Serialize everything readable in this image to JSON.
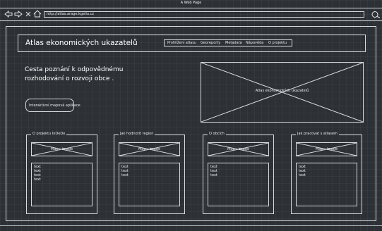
{
  "window": {
    "title": "A Web Page"
  },
  "browser": {
    "url": "http://atlas.arage.kgeliu.cz"
  },
  "header": {
    "site_title": "Atlas ekonomických ukazatelů",
    "nav": [
      "Prohlížení atlasu",
      "Georeporty",
      "Metadata",
      "Nápověda",
      "O projektu"
    ]
  },
  "hero": {
    "tagline_line1": "Cesta poznání k odpovědnému",
    "tagline_line2": "rozhodování o rozvoji obce .",
    "button_label": "Interaktivní mapová aplikace",
    "image_label": "Atlas ekonomických ukazatelů"
  },
  "cards": [
    {
      "title": "O projektu InDeDe",
      "image_label": "Map - image",
      "lines": [
        "text",
        "text",
        "text",
        "text"
      ]
    },
    {
      "title": "Jak hodnotit region",
      "image_label": "Map - image",
      "lines": [
        "text",
        "text",
        "text"
      ]
    },
    {
      "title": "O obcích",
      "image_label": "Map - image",
      "lines": [
        "text",
        "text",
        "text"
      ]
    },
    {
      "title": "Jak pracovat s atlasem",
      "image_label": "Map - image",
      "lines": [
        "text",
        "text",
        "text"
      ]
    }
  ]
}
